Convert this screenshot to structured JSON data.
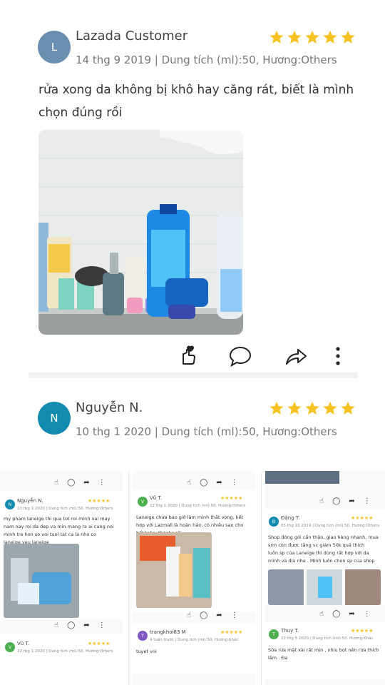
{
  "reviews": [
    {
      "avatar_letter": "L",
      "avatar_color": "#6b8fb0",
      "name": "Lazada Customer",
      "meta": "14 thg 9 2019 | Dung tích (ml):50, Hương:Others",
      "rating": 5,
      "text": "rửa xong da không bị khô hay căng rát, biết là mình chọn đúng rồi",
      "photo_icon": "skincare-products-photo"
    },
    {
      "avatar_letter": "N",
      "avatar_color": "#138ab0",
      "name": "Nguyễn N.",
      "meta": "10 thg 1 2020 | Dung tích (ml):50, Hương:Others",
      "rating": 5
    }
  ],
  "actions": [
    "like-icon",
    "comment-icon",
    "share-icon",
    "more-icon"
  ],
  "star_color": "#f7c323",
  "thumbnails": [
    {
      "name": "Nguyễn N.",
      "meta": "10 thg 1 2020 | Dung tích (ml):50, Hương:Others",
      "text": "my pham laneige thi qua tot roi minh xai may nam nay roi da dep va min mang ra ai cung noi minh tre hon so voi tuoi tat ca la nho co laneige.yeu laneige",
      "avatar_letter": "N",
      "avatar_color": "#138ab0",
      "next_name": "Vũ T.",
      "next_meta": "22 thg 1 2020 | Dung tích (ml):50, Hương:Others",
      "next_avatar": "V",
      "next_avatar_color": "#4caf50"
    },
    {
      "name": "Vũ T.",
      "meta": "22 thg 1 2020 | Dung tích (ml):50, Hương:Others",
      "text": "Laneige chưa bao giờ làm mình thất vọng, kết hợp với Lazmall là hoàn hảo, có nhiều sao cho hết luôn, thanks all",
      "avatar_letter": "V",
      "avatar_color": "#4caf50",
      "next_name": "trangkhoi83 M",
      "next_meta": "4 tuần trước | Dung tích (ml):50, Hương:Khác",
      "next_text": "tuyet voi",
      "next_avatar": "T",
      "next_avatar_color": "#7e57c2"
    },
    {
      "name": "Đặng T.",
      "meta": "05 thg 10 2019 | Dung tích (ml):50, Hương:Others",
      "text": "Shop đóng gói cẩn thận, giao hàng nhanh, mua srm còn được tặng vc giảm 50k quá thích luôn.sp của Laneige thì dùng rất hợp với da mình và dịu nhẹ . Mình luôn chọn sp của shop",
      "avatar_letter": "Đ",
      "avatar_color": "#138ab0",
      "next_name": "Thuy T.",
      "next_meta": "22 thg 5 2020 | Dung tích (ml):50, Hương:Khác",
      "next_text": "Sữa rửa mặt xài rất mịn , nhiu bọt nên rửa thích lắm . Đa",
      "next_avatar": "T",
      "next_avatar_color": "#4caf50"
    }
  ]
}
